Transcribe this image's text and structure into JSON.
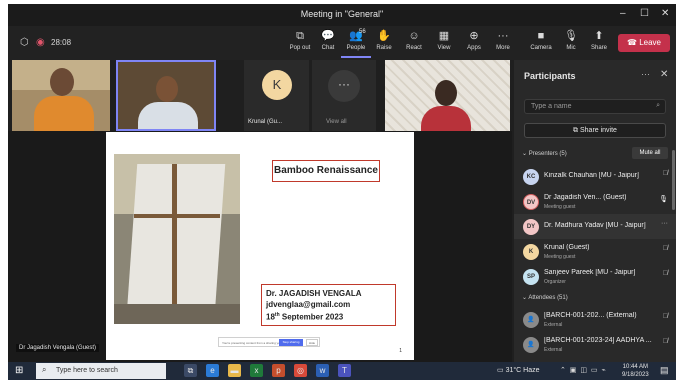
{
  "window": {
    "title": "Meeting in \"General\"",
    "controls": [
      "–",
      "☐",
      "✕"
    ]
  },
  "toolbar": {
    "timer": "28:08",
    "items": [
      {
        "label": "Pop out",
        "icon": "⧉"
      },
      {
        "label": "Chat",
        "icon": "💬"
      },
      {
        "label": "People",
        "icon": "👥",
        "count": "56"
      },
      {
        "label": "Raise",
        "icon": "✋"
      },
      {
        "label": "React",
        "icon": "☺"
      },
      {
        "label": "View",
        "icon": "▦"
      },
      {
        "label": "Apps",
        "icon": "⊕"
      },
      {
        "label": "More",
        "icon": "···"
      }
    ],
    "media": [
      {
        "label": "Camera",
        "icon": "■"
      },
      {
        "label": "Mic",
        "icon": "🎙"
      },
      {
        "label": "Share",
        "icon": "⬆"
      }
    ],
    "leave": {
      "label": "Leave",
      "icon": "☎"
    }
  },
  "videos": {
    "krunal_initial": "K",
    "krunal_name": "Krunal (Gu...",
    "view_all": "View all"
  },
  "slide": {
    "title": "Bamboo Renaissance",
    "name": "Dr. JAGADISH VENGALA",
    "email": "jdvenglaa@gmail.com",
    "date_day": "18",
    "date_sup": "th",
    "date_rest": " September 2023",
    "share_bar_text": "You're presenting content from a sharing your screen",
    "share_bar_stop": "Stop sharing",
    "share_bar_other": "Hide",
    "page": "1"
  },
  "presenter_label": "Dr Jagadish Vengala (Guest)",
  "participants": {
    "title": "Participants",
    "more": "···",
    "close": "✕",
    "search_placeholder": "Type a name",
    "share_invite": "Share invite",
    "presenters_label": "Presenters (5)",
    "mute_all": "Mute all",
    "presenters": [
      {
        "initials": "KC",
        "name": "Kinzalk Chauhan [MU - Jaipur]",
        "role": "",
        "color": "#c7d4ef",
        "status": "mic-off"
      },
      {
        "initials": "DV",
        "name": "Dr Jagadish Ven... (Guest)",
        "role": "Meeting guest",
        "color": "#f2c6c6",
        "status": "mic-on"
      },
      {
        "initials": "DY",
        "name": "Dr. Madhura Yadav [MU - Jaipur]",
        "role": "",
        "color": "#f2c6c6",
        "status": "more"
      },
      {
        "initials": "K",
        "name": "Krunal (Guest)",
        "role": "Meeting guest",
        "color": "#f3d7a1",
        "status": "mic-off"
      },
      {
        "initials": "SP",
        "name": "Sanjeev Pareek [MU - Jaipur]",
        "role": "Organizer",
        "color": "#c5e3f1",
        "status": "mic-off"
      }
    ],
    "attendees_label": "Attendees (51)",
    "attendees": [
      {
        "initials": "",
        "name": "[BARCH-001-202... (External)",
        "role": "External",
        "color": "#8a8a8a",
        "status": "mic-off"
      },
      {
        "initials": "",
        "name": "[BARCH-001-2023-24] AADHYA ...",
        "role": "External",
        "color": "#8a8a8a",
        "status": "mic-off"
      }
    ]
  },
  "taskbar": {
    "search_placeholder": "Type here to search",
    "weather": "31°C Haze",
    "time": "10:44 AM",
    "date": "9/18/2023"
  }
}
